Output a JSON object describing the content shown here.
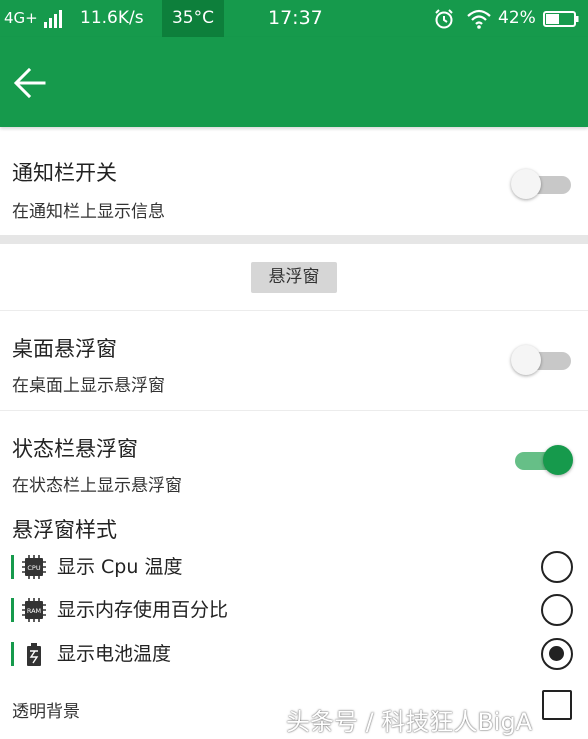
{
  "status_bar": {
    "network": "4G+",
    "speed": "11.6K/s",
    "temperature": "35°C",
    "time": "17:37",
    "battery": "42%",
    "icons": [
      "signal-icon",
      "alarm-icon",
      "wifi-icon",
      "battery-icon"
    ]
  },
  "appbar": {
    "back_icon": "arrow-left-icon",
    "color": "#169a4c"
  },
  "notification": {
    "title": "通知栏开关",
    "subtitle": "在通知栏上显示信息",
    "enabled": false
  },
  "section": {
    "label": "悬浮窗"
  },
  "desktop_float": {
    "title": "桌面悬浮窗",
    "subtitle": "在桌面上显示悬浮窗",
    "enabled": false
  },
  "statusbar_float": {
    "title": "状态栏悬浮窗",
    "subtitle": "在状态栏上显示悬浮窗",
    "enabled": true
  },
  "style": {
    "title": "悬浮窗样式",
    "options": [
      {
        "icon_text": "CPU",
        "label": "显示 Cpu 温度",
        "selected": false
      },
      {
        "icon_text": "RAM",
        "label": "显示内存使用百分比",
        "selected": false
      },
      {
        "icon_text": "",
        "label": "显示电池温度",
        "selected": true
      }
    ]
  },
  "transparent": {
    "label": "透明背景",
    "checked": false
  },
  "watermark": "头条号 / 科技狂人BigA"
}
